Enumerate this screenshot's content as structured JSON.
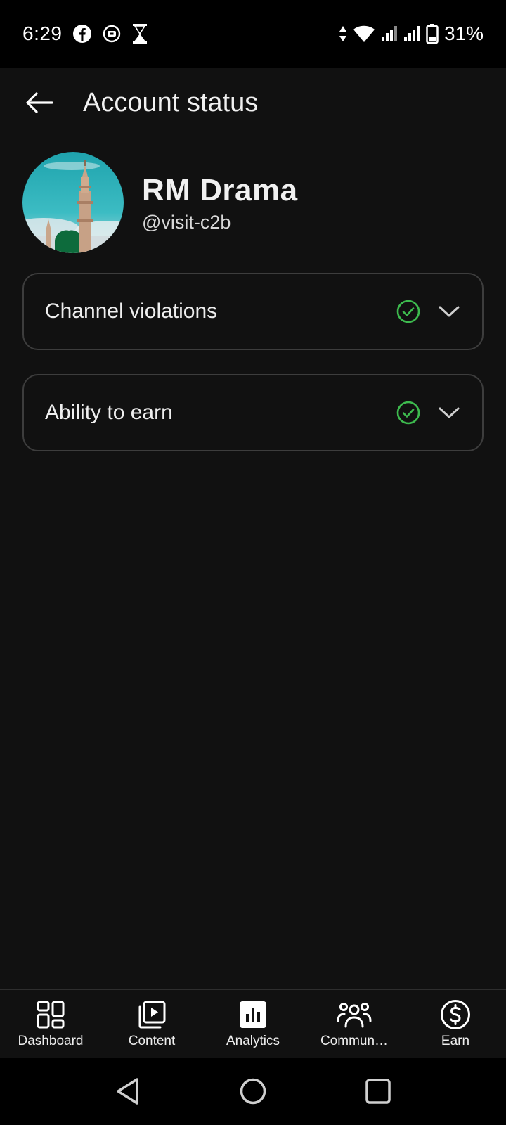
{
  "status_bar": {
    "time": "6:29",
    "battery": "31%",
    "icons": [
      "facebook-icon",
      "cast-icon",
      "hourglass-icon",
      "data-arrows-icon",
      "wifi-icon",
      "signal-icon",
      "signal-icon",
      "battery-icon"
    ]
  },
  "app_bar": {
    "title": "Account status",
    "back_icon": "arrow-back-icon"
  },
  "profile": {
    "name": "RM Drama",
    "handle": "@visit-c2b"
  },
  "cards": [
    {
      "label": "Channel violations",
      "status_icon": "check-circle-icon",
      "expand_icon": "chevron-down-icon"
    },
    {
      "label": "Ability to earn",
      "status_icon": "check-circle-icon",
      "expand_icon": "chevron-down-icon"
    }
  ],
  "bottom_nav": {
    "items": [
      {
        "label": "Dashboard",
        "icon": "dashboard-icon"
      },
      {
        "label": "Content",
        "icon": "content-icon"
      },
      {
        "label": "Analytics",
        "icon": "analytics-icon"
      },
      {
        "label": "Commun…",
        "icon": "community-icon"
      },
      {
        "label": "Earn",
        "icon": "earn-icon"
      }
    ]
  },
  "colors": {
    "background": "#111111",
    "success": "#3dba4e",
    "card_border": "#3d3d3d",
    "system_bar": "#000000"
  }
}
